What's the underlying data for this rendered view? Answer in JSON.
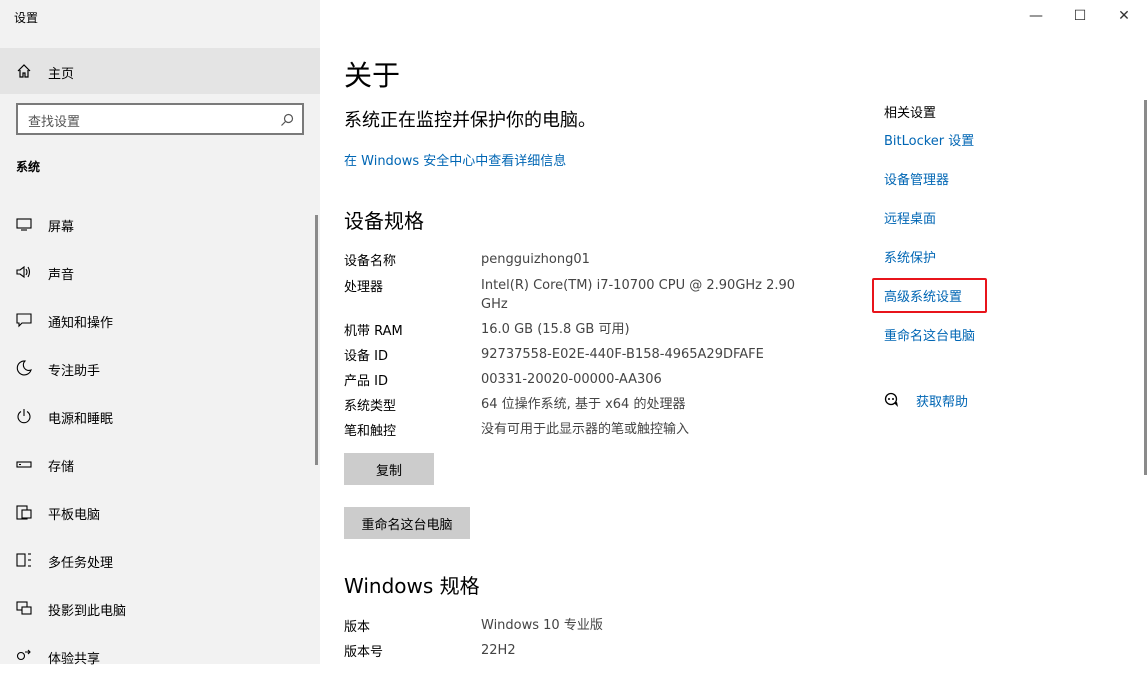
{
  "app": {
    "title": "设置"
  },
  "window_controls": {
    "minimize": "—",
    "maximize": "☐",
    "close": "✕"
  },
  "sidebar": {
    "home_label": "主页",
    "search_placeholder": "查找设置",
    "section": "系统",
    "items": [
      {
        "label": "屏幕",
        "icon": "display-icon"
      },
      {
        "label": "声音",
        "icon": "speaker-icon"
      },
      {
        "label": "通知和操作",
        "icon": "notification-icon"
      },
      {
        "label": "专注助手",
        "icon": "moon-icon"
      },
      {
        "label": "电源和睡眠",
        "icon": "power-icon"
      },
      {
        "label": "存储",
        "icon": "storage-icon"
      },
      {
        "label": "平板电脑",
        "icon": "tablet-icon"
      },
      {
        "label": "多任务处理",
        "icon": "multitask-icon"
      },
      {
        "label": "投影到此电脑",
        "icon": "project-icon"
      },
      {
        "label": "体验共享",
        "icon": "share-icon"
      }
    ]
  },
  "main": {
    "title": "关于",
    "protect_text": "系统正在监控并保护你的电脑。",
    "security_link": "在 Windows 安全中心中查看详细信息",
    "device_specs_title": "设备规格",
    "device_specs": [
      {
        "key": "设备名称",
        "value": "pengguizhong01"
      },
      {
        "key": "处理器",
        "value": "Intel(R) Core(TM) i7-10700 CPU @ 2.90GHz   2.90 GHz"
      },
      {
        "key": "机带 RAM",
        "value": "16.0 GB (15.8 GB 可用)"
      },
      {
        "key": "设备 ID",
        "value": "92737558-E02E-440F-B158-4965A29DFAFE"
      },
      {
        "key": "产品 ID",
        "value": "00331-20020-00000-AA306"
      },
      {
        "key": "系统类型",
        "value": "64 位操作系统, 基于 x64 的处理器"
      },
      {
        "key": "笔和触控",
        "value": "没有可用于此显示器的笔或触控输入"
      }
    ],
    "copy_button": "复制",
    "rename_button": "重命名这台电脑",
    "windows_specs_title": "Windows 规格",
    "windows_specs": [
      {
        "key": "版本",
        "value": "Windows 10 专业版"
      },
      {
        "key": "版本号",
        "value": "22H2"
      }
    ]
  },
  "related": {
    "title": "相关设置",
    "links": [
      "BitLocker 设置",
      "设备管理器",
      "远程桌面",
      "系统保护",
      "高级系统设置",
      "重命名这台电脑"
    ],
    "help": "获取帮助"
  },
  "colors": {
    "link": "#0066b4",
    "highlight": "#e8141b",
    "sidebar_bg": "#f2f2f2"
  }
}
